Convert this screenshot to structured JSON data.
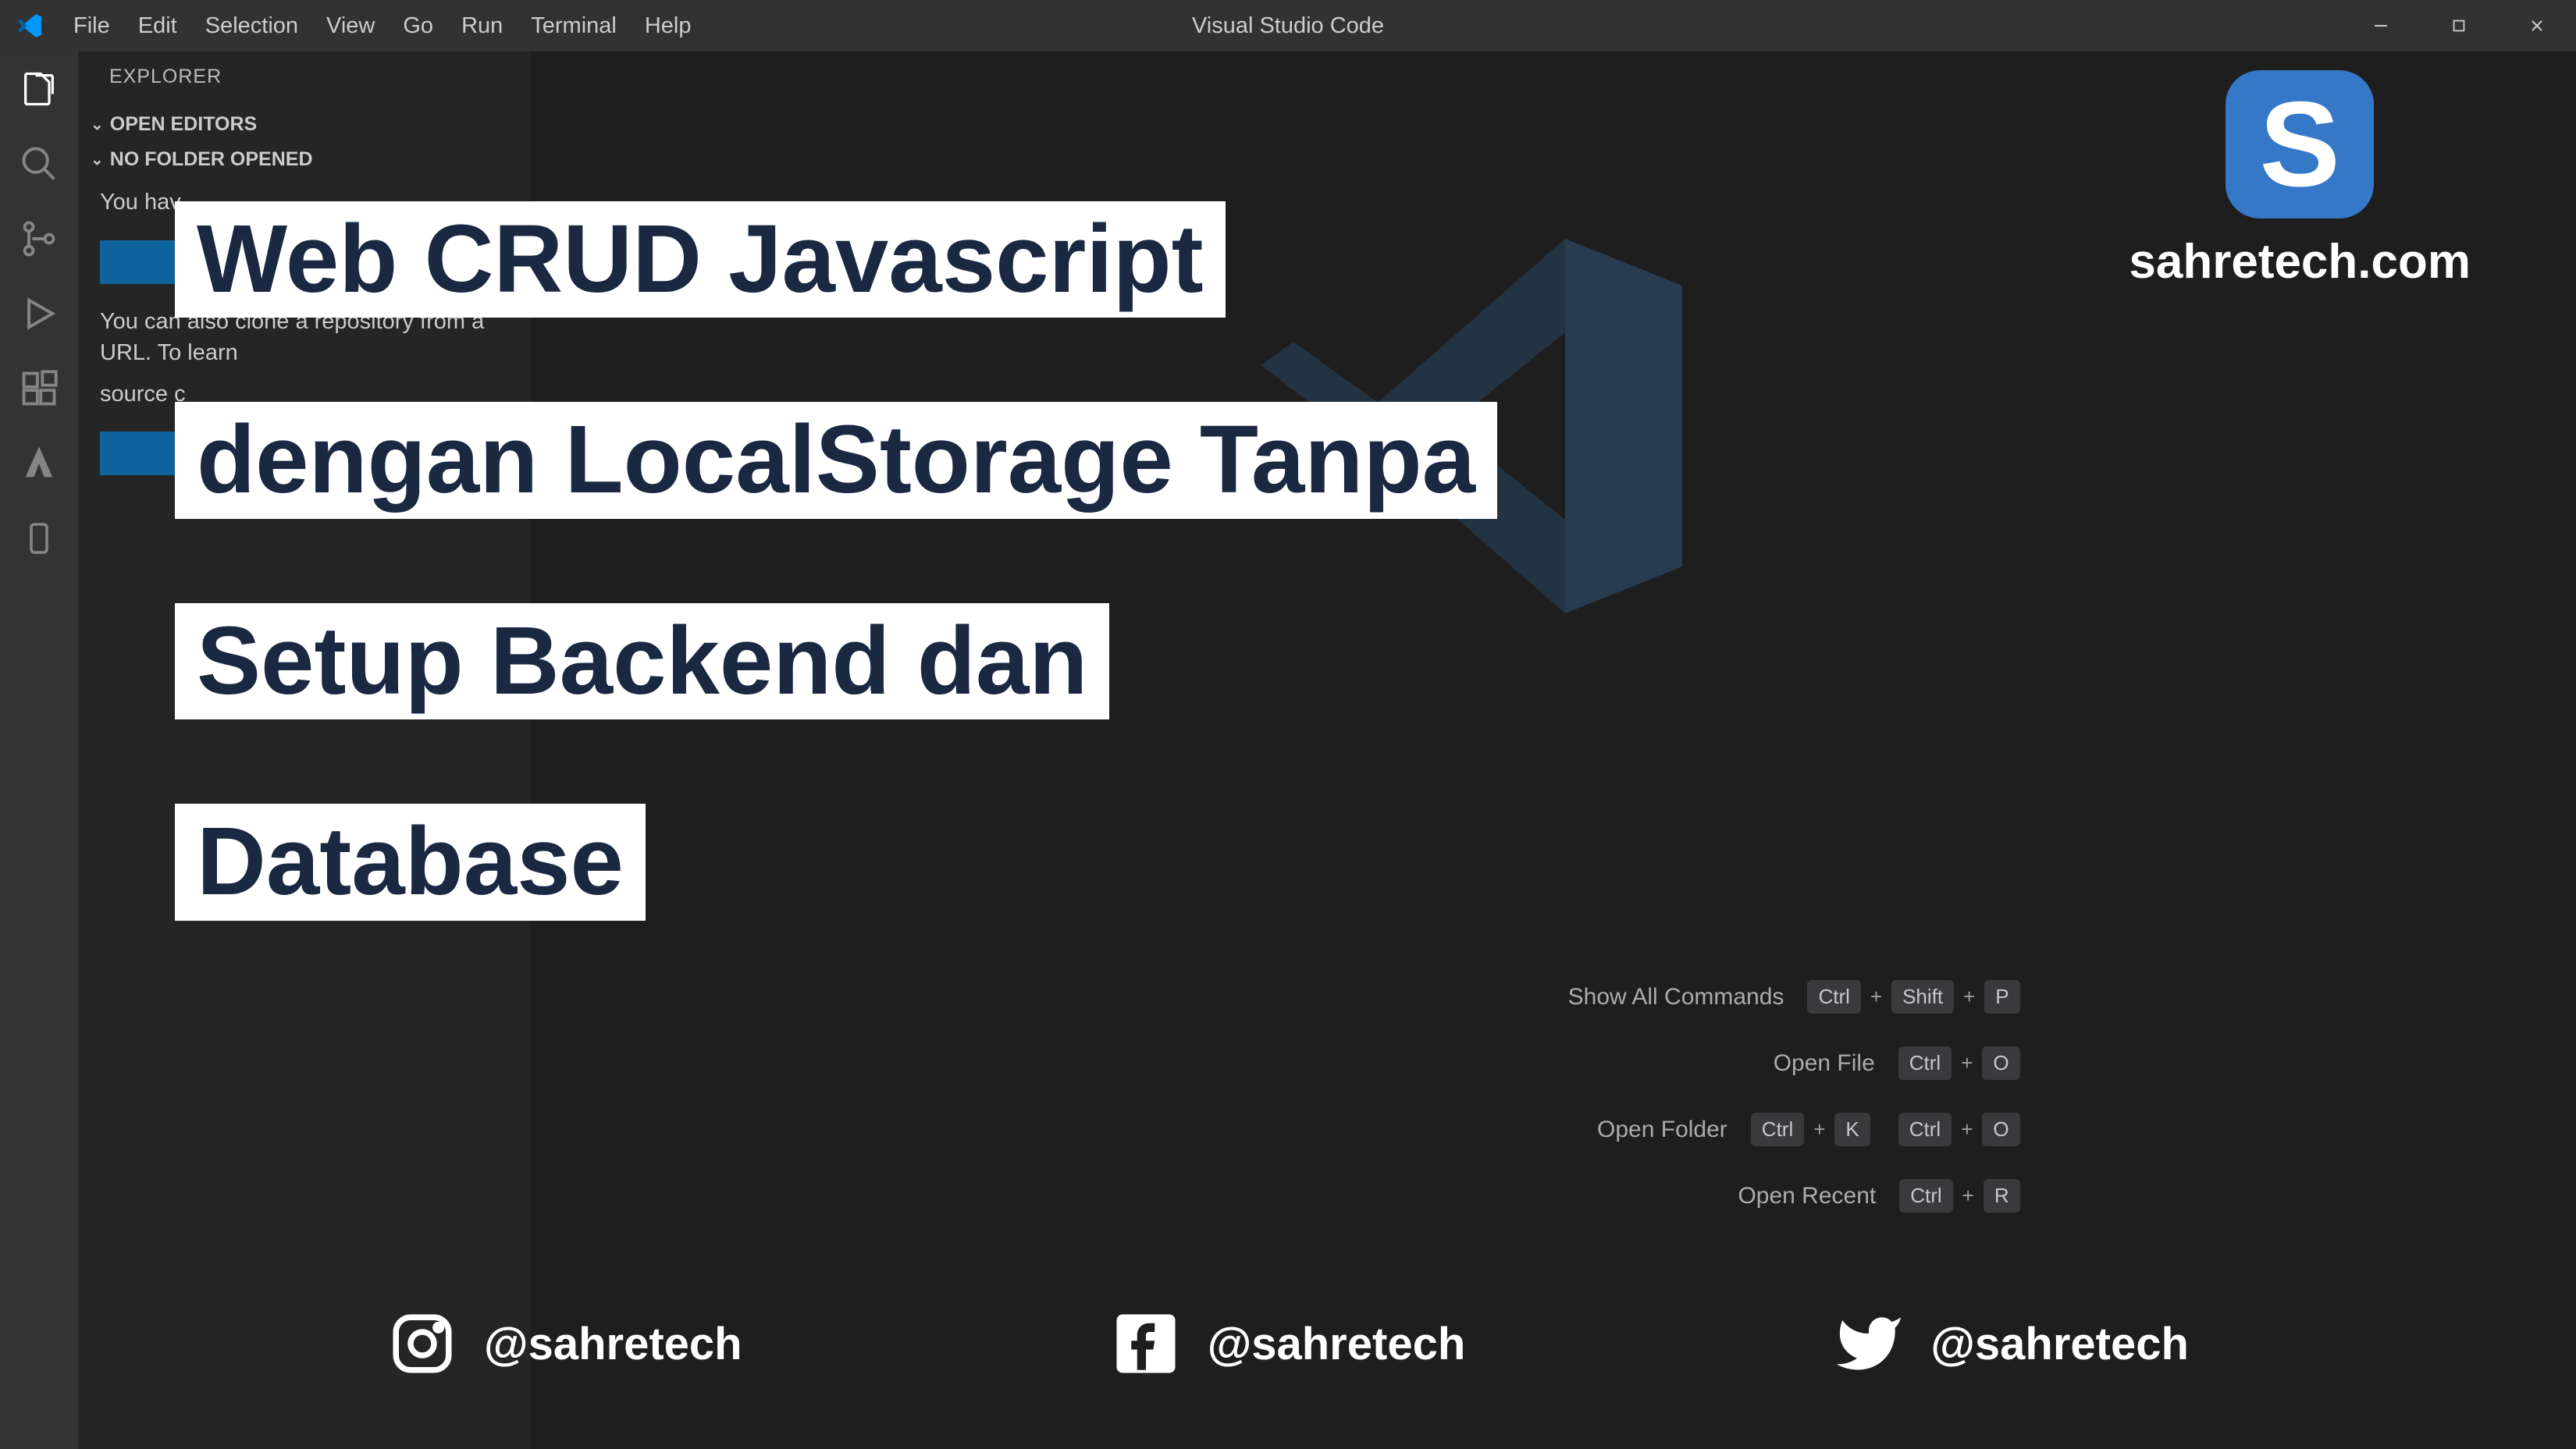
{
  "window": {
    "title": "Visual Studio Code"
  },
  "menu": [
    "File",
    "Edit",
    "Selection",
    "View",
    "Go",
    "Run",
    "Terminal",
    "Help"
  ],
  "sidebar": {
    "title": "EXPLORER",
    "sections": [
      "OPEN EDITORS",
      "NO FOLDER OPENED"
    ],
    "text1": "You hav",
    "text2": "You can also clone a repository from a URL. To learn",
    "text3": "source c"
  },
  "shortcuts": [
    {
      "label": "Show All Commands",
      "keys": [
        "Ctrl",
        "Shift",
        "P"
      ]
    },
    {
      "label": "Open File",
      "keys": [
        "Ctrl",
        "O"
      ]
    },
    {
      "label": "Open Folder",
      "keys": [
        "Ctrl",
        "K",
        "Ctrl",
        "O"
      ]
    },
    {
      "label": "Open Recent",
      "keys": [
        "Ctrl",
        "R"
      ]
    }
  ],
  "overlay": {
    "line1": "Web CRUD Javascript",
    "line2": "dengan LocalStorage Tanpa",
    "line3": "Setup Backend dan",
    "line4": "Database"
  },
  "brand": {
    "letter": "S",
    "text": "sahretech.com"
  },
  "socials": {
    "instagram": "@sahretech",
    "facebook": "@sahretech",
    "twitter": "@sahretech"
  }
}
